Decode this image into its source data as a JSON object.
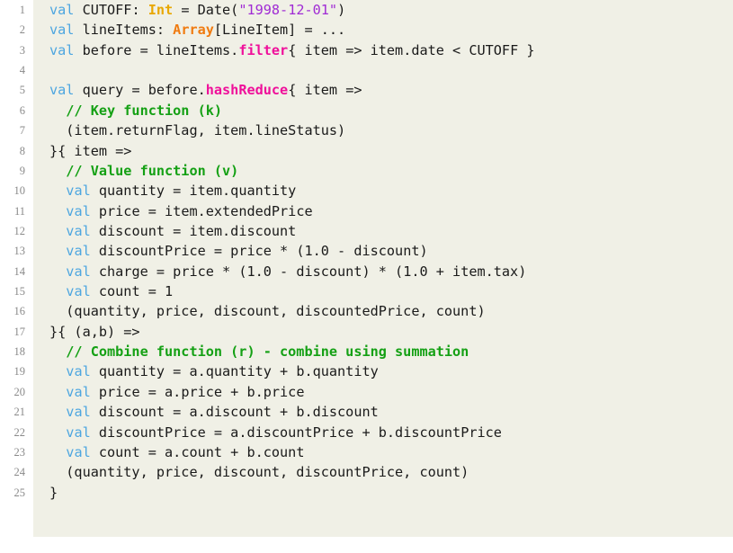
{
  "editor": {
    "language": "scala",
    "background_color": "#f0f0e6",
    "page_background_color": "#ffffff",
    "gutter_color": "#8a8a8a",
    "total_lines": 25,
    "palette": {
      "keyword": "#4da6e0",
      "type_primary": "#e8a700",
      "type_secondary": "#f07b10",
      "string": "#a02bd4",
      "method": "#ef0f9a",
      "comment": "#14a014",
      "text": "#1a1a1a"
    }
  },
  "lines": [
    {
      "n": "1",
      "tokens": [
        {
          "t": "val",
          "c": "kw"
        },
        {
          "t": " CUTOFF: ",
          "c": "plain"
        },
        {
          "t": "Int",
          "c": "type-a"
        },
        {
          "t": " = Date(",
          "c": "plain"
        },
        {
          "t": "\"1998-12-01\"",
          "c": "str"
        },
        {
          "t": ")",
          "c": "plain"
        }
      ]
    },
    {
      "n": "2",
      "tokens": [
        {
          "t": "val",
          "c": "kw"
        },
        {
          "t": " lineItems: ",
          "c": "plain"
        },
        {
          "t": "Array",
          "c": "type-b"
        },
        {
          "t": "[LineItem] = ...",
          "c": "plain"
        }
      ]
    },
    {
      "n": "3",
      "tokens": [
        {
          "t": "val",
          "c": "kw"
        },
        {
          "t": " before = lineItems.",
          "c": "plain"
        },
        {
          "t": "filter",
          "c": "meth"
        },
        {
          "t": "{ item => item.date < CUTOFF }",
          "c": "plain"
        }
      ]
    },
    {
      "n": "4",
      "tokens": []
    },
    {
      "n": "5",
      "tokens": [
        {
          "t": "val",
          "c": "kw"
        },
        {
          "t": " query = before.",
          "c": "plain"
        },
        {
          "t": "hashReduce",
          "c": "meth"
        },
        {
          "t": "{ item =>",
          "c": "plain"
        }
      ]
    },
    {
      "n": "6",
      "tokens": [
        {
          "t": "  // Key function (k)",
          "c": "cmt"
        }
      ]
    },
    {
      "n": "7",
      "tokens": [
        {
          "t": "  (item.returnFlag, item.lineStatus)",
          "c": "plain"
        }
      ]
    },
    {
      "n": "8",
      "tokens": [
        {
          "t": "}{ item =>",
          "c": "plain"
        }
      ]
    },
    {
      "n": "9",
      "tokens": [
        {
          "t": "  // Value function (v)",
          "c": "cmt"
        }
      ]
    },
    {
      "n": "10",
      "tokens": [
        {
          "t": "  ",
          "c": "plain"
        },
        {
          "t": "val",
          "c": "kw"
        },
        {
          "t": " quantity = item.quantity",
          "c": "plain"
        }
      ]
    },
    {
      "n": "11",
      "tokens": [
        {
          "t": "  ",
          "c": "plain"
        },
        {
          "t": "val",
          "c": "kw"
        },
        {
          "t": " price = item.extendedPrice",
          "c": "plain"
        }
      ]
    },
    {
      "n": "12",
      "tokens": [
        {
          "t": "  ",
          "c": "plain"
        },
        {
          "t": "val",
          "c": "kw"
        },
        {
          "t": " discount = item.discount",
          "c": "plain"
        }
      ]
    },
    {
      "n": "13",
      "tokens": [
        {
          "t": "  ",
          "c": "plain"
        },
        {
          "t": "val",
          "c": "kw"
        },
        {
          "t": " discountPrice = price * (1.0 - discount)",
          "c": "plain"
        }
      ]
    },
    {
      "n": "14",
      "tokens": [
        {
          "t": "  ",
          "c": "plain"
        },
        {
          "t": "val",
          "c": "kw"
        },
        {
          "t": " charge = price * (1.0 - discount) * (1.0 + item.tax)",
          "c": "plain"
        }
      ]
    },
    {
      "n": "15",
      "tokens": [
        {
          "t": "  ",
          "c": "plain"
        },
        {
          "t": "val",
          "c": "kw"
        },
        {
          "t": " count = 1",
          "c": "plain"
        }
      ]
    },
    {
      "n": "16",
      "tokens": [
        {
          "t": "  (quantity, price, discount, discountedPrice, count)",
          "c": "plain"
        }
      ]
    },
    {
      "n": "17",
      "tokens": [
        {
          "t": "}{ (a,b) =>",
          "c": "plain"
        }
      ]
    },
    {
      "n": "18",
      "tokens": [
        {
          "t": "  // Combine function (r) - combine using summation",
          "c": "cmt"
        }
      ]
    },
    {
      "n": "19",
      "tokens": [
        {
          "t": "  ",
          "c": "plain"
        },
        {
          "t": "val",
          "c": "kw"
        },
        {
          "t": " quantity = a.quantity + b.quantity",
          "c": "plain"
        }
      ]
    },
    {
      "n": "20",
      "tokens": [
        {
          "t": "  ",
          "c": "plain"
        },
        {
          "t": "val",
          "c": "kw"
        },
        {
          "t": " price = a.price + b.price",
          "c": "plain"
        }
      ]
    },
    {
      "n": "21",
      "tokens": [
        {
          "t": "  ",
          "c": "plain"
        },
        {
          "t": "val",
          "c": "kw"
        },
        {
          "t": " discount = a.discount + b.discount",
          "c": "plain"
        }
      ]
    },
    {
      "n": "22",
      "tokens": [
        {
          "t": "  ",
          "c": "plain"
        },
        {
          "t": "val",
          "c": "kw"
        },
        {
          "t": " discountPrice = a.discountPrice + b.discountPrice",
          "c": "plain"
        }
      ]
    },
    {
      "n": "23",
      "tokens": [
        {
          "t": "  ",
          "c": "plain"
        },
        {
          "t": "val",
          "c": "kw"
        },
        {
          "t": " count = a.count + b.count",
          "c": "plain"
        }
      ]
    },
    {
      "n": "24",
      "tokens": [
        {
          "t": "  (quantity, price, discount, discountPrice, count)",
          "c": "plain"
        }
      ]
    },
    {
      "n": "25",
      "tokens": [
        {
          "t": "}",
          "c": "plain"
        }
      ]
    }
  ]
}
